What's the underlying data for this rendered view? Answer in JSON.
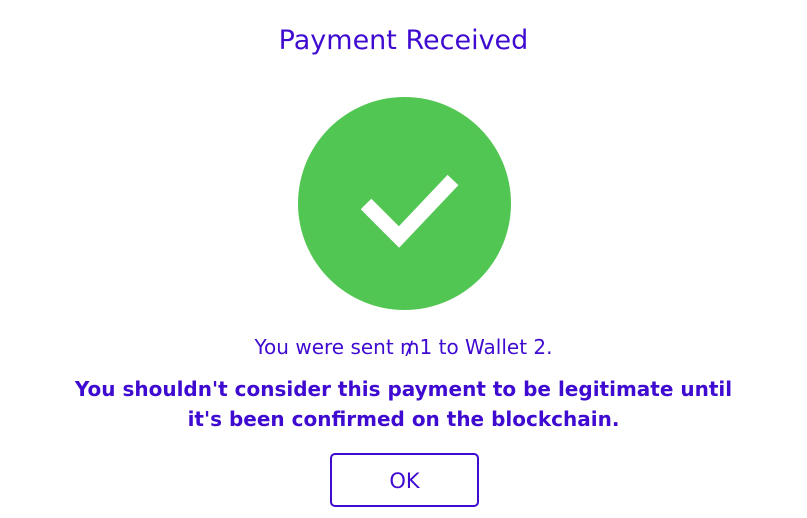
{
  "dialog": {
    "title": "Payment Received",
    "message": "You were sent ₥1 to Wallet 2.",
    "warning": "You shouldn't consider this payment to be legitimate until it's been confirmed on the blockchain.",
    "ok_label": "OK",
    "icon": "checkmark-success-icon"
  },
  "colors": {
    "text_accent": "#3f0bd1",
    "success_green": "#52c652",
    "checkmark": "#ffffff",
    "background": "#ffffff"
  }
}
